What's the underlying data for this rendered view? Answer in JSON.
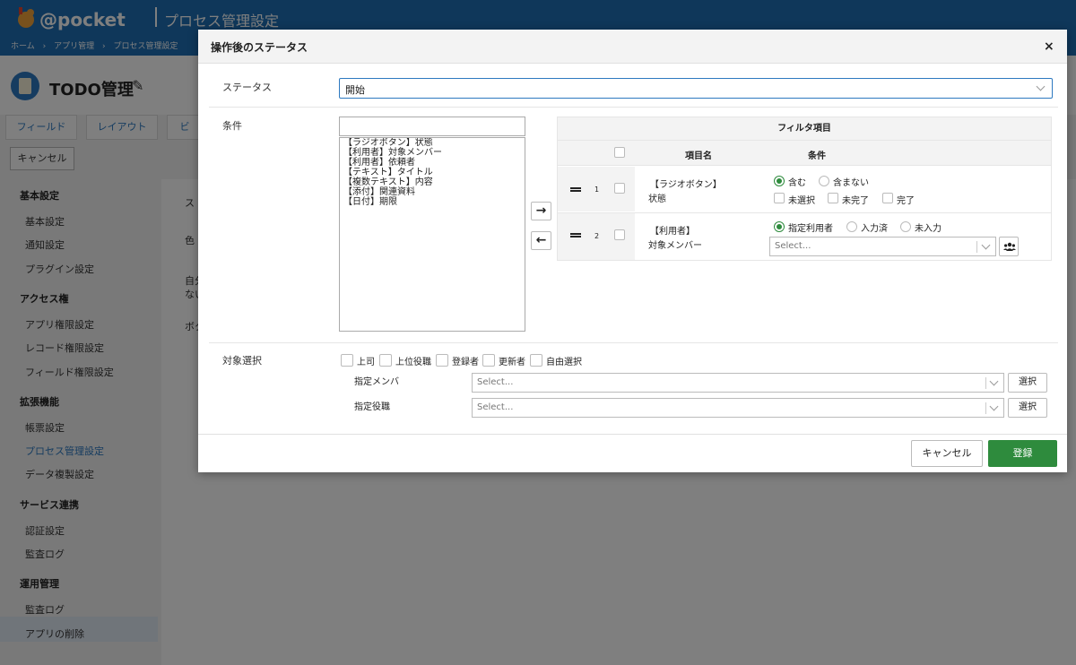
{
  "app": {
    "logo_text": "@pocket",
    "page_title": "プロセス管理設定",
    "breadcrumb": [
      "ホーム",
      "›",
      "アプリ管理",
      "›",
      "プロセス管理設定"
    ],
    "app_name": "TODO管理",
    "tabs": [
      "フィールド",
      "レイアウト",
      "ビ"
    ],
    "cancel_label": "キャンセル",
    "sidebar": {
      "groups": [
        {
          "title": "基本設定",
          "items": [
            "基本設定",
            "通知設定",
            "プラグイン設定"
          ]
        },
        {
          "title": "アクセス権",
          "items": [
            "アプリ権限設定",
            "レコード権限設定",
            "フィールド権限設定"
          ]
        },
        {
          "title": "拡張機能",
          "items": [
            "帳票設定",
            "プロセス管理設定",
            "データ複製設定"
          ]
        },
        {
          "title": "サービス連携",
          "items": [
            "認証設定",
            "監査ログ"
          ]
        },
        {
          "title": "運用管理",
          "items": [
            "監査ログ",
            "アプリの削除"
          ]
        }
      ]
    },
    "main_fragments": [
      "ス",
      "色",
      "自分",
      "ない",
      "ボタ"
    ]
  },
  "modal": {
    "title": "操作後のステータス",
    "close": "×",
    "status_label": "ステータス",
    "status_value": "開始",
    "condition_label": "条件",
    "condition_search_value": "",
    "condition_items": [
      "【ラジオボタン】状態",
      "【利用者】対象メンバー",
      "【利用者】依頼者",
      "【テキスト】タイトル",
      "【複数テキスト】内容",
      "【添付】関連資料",
      "【日付】期限"
    ],
    "arrow_right": "→",
    "arrow_left": "←",
    "filter": {
      "title": "フィルタ項目",
      "col_name": "項目名",
      "col_condition": "条件",
      "rows": [
        {
          "num": "1",
          "name_line1": "【ラジオボタン】",
          "name_line2": "状態",
          "radios": [
            {
              "label": "含む",
              "checked": true
            },
            {
              "label": "含まない",
              "checked": false
            }
          ],
          "checks": [
            "未選択",
            "未完了",
            "完了"
          ]
        },
        {
          "num": "2",
          "name_line1": "【利用者】",
          "name_line2": "対象メンバー",
          "radios": [
            {
              "label": "指定利用者",
              "checked": true
            },
            {
              "label": "入力済",
              "checked": false
            },
            {
              "label": "未入力",
              "checked": false
            }
          ],
          "select_placeholder": "Select..."
        }
      ]
    },
    "target_label": "対象選択",
    "target_checks": [
      "上司",
      "上位役職",
      "登録者",
      "更新者",
      "自由選択"
    ],
    "member_label": "指定メンバ",
    "member_placeholder": "Select...",
    "role_label": "指定役職",
    "role_placeholder": "Select...",
    "pick_label": "選択",
    "cancel_label": "キャンセル",
    "save_label": "登録",
    "accent_color": "#2e8b3d",
    "brand_color": "#1f6fb5"
  }
}
